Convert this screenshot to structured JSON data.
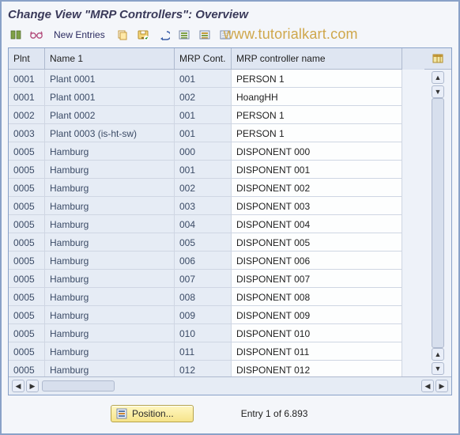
{
  "title": "Change View \"MRP Controllers\": Overview",
  "toolbar": {
    "new_entries_label": "New Entries"
  },
  "watermark": "www.tutorialkart.com",
  "columns": {
    "plnt": "Plnt",
    "name1": "Name 1",
    "mrp_cont": "MRP Cont.",
    "mrp_controller_name": "MRP controller name"
  },
  "rows": [
    {
      "plnt": "0001",
      "name1": "Plant 0001",
      "mrp_cont": "001",
      "mrp_controller_name": "PERSON 1"
    },
    {
      "plnt": "0001",
      "name1": "Plant 0001",
      "mrp_cont": "002",
      "mrp_controller_name": "HoangHH"
    },
    {
      "plnt": "0002",
      "name1": "Plant 0002",
      "mrp_cont": "001",
      "mrp_controller_name": "PERSON 1"
    },
    {
      "plnt": "0003",
      "name1": "Plant 0003 (is-ht-sw)",
      "mrp_cont": "001",
      "mrp_controller_name": "PERSON 1"
    },
    {
      "plnt": "0005",
      "name1": "Hamburg",
      "mrp_cont": "000",
      "mrp_controller_name": "DISPONENT 000"
    },
    {
      "plnt": "0005",
      "name1": "Hamburg",
      "mrp_cont": "001",
      "mrp_controller_name": "DISPONENT 001"
    },
    {
      "plnt": "0005",
      "name1": "Hamburg",
      "mrp_cont": "002",
      "mrp_controller_name": "DISPONENT 002"
    },
    {
      "plnt": "0005",
      "name1": "Hamburg",
      "mrp_cont": "003",
      "mrp_controller_name": "DISPONENT 003"
    },
    {
      "plnt": "0005",
      "name1": "Hamburg",
      "mrp_cont": "004",
      "mrp_controller_name": "DISPONENT 004"
    },
    {
      "plnt": "0005",
      "name1": "Hamburg",
      "mrp_cont": "005",
      "mrp_controller_name": "DISPONENT 005"
    },
    {
      "plnt": "0005",
      "name1": "Hamburg",
      "mrp_cont": "006",
      "mrp_controller_name": "DISPONENT 006"
    },
    {
      "plnt": "0005",
      "name1": "Hamburg",
      "mrp_cont": "007",
      "mrp_controller_name": "DISPONENT 007"
    },
    {
      "plnt": "0005",
      "name1": "Hamburg",
      "mrp_cont": "008",
      "mrp_controller_name": "DISPONENT 008"
    },
    {
      "plnt": "0005",
      "name1": "Hamburg",
      "mrp_cont": "009",
      "mrp_controller_name": "DISPONENT 009"
    },
    {
      "plnt": "0005",
      "name1": "Hamburg",
      "mrp_cont": "010",
      "mrp_controller_name": "DISPONENT 010"
    },
    {
      "plnt": "0005",
      "name1": "Hamburg",
      "mrp_cont": "011",
      "mrp_controller_name": "DISPONENT 011"
    },
    {
      "plnt": "0005",
      "name1": "Hamburg",
      "mrp_cont": "012",
      "mrp_controller_name": "DISPONENT 012"
    }
  ],
  "footer": {
    "position_label": "Position...",
    "entry_count_label": "Entry 1 of 6.893"
  }
}
